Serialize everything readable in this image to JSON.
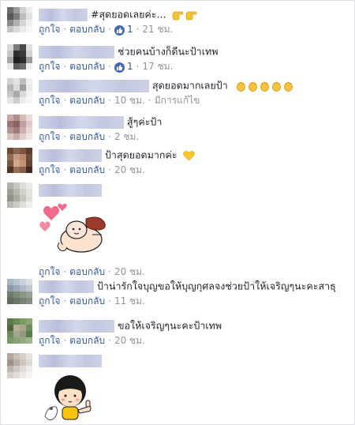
{
  "comments": [
    {
      "text": "#สุดยอดเลยค่ะ",
      "trailing": "...",
      "emoji": [
        "thumb-pointing-icon",
        "thumb-pointing-icon"
      ],
      "like": "ถูกใจ",
      "reply": "ตอบกลับ",
      "reactions": "1",
      "time": "21 ชม."
    },
    {
      "text": "ช่วยคนบ้างก็ดีนะป้าเทพ",
      "like": "ถูกใจ",
      "reply": "ตอบกลับ",
      "reactions": "1",
      "time": "17 ชม."
    },
    {
      "text": "สุดยอดมากเลยป้า",
      "emoji": [
        "clap-icon",
        "clap-icon",
        "clap-icon",
        "clap-icon",
        "clap-icon"
      ],
      "like": "ถูกใจ",
      "reply": "ตอบกลับ",
      "time": "10 ชม.",
      "edited": "มีการแก้ไข"
    },
    {
      "text": "สู้ๆค่ะป้า",
      "like": "ถูกใจ",
      "reply": "ตอบกลับ",
      "time": "2 ชม."
    },
    {
      "text": "ป้าสุดยอดมากค่ะ",
      "emoji": [
        "yellow-heart-icon"
      ],
      "like": "ถูกใจ",
      "reply": "ตอบกลับ",
      "time": "20 ชม."
    },
    {
      "sticker": "hearts-sticker",
      "like": "ถูกใจ",
      "reply": "ตอบกลับ",
      "time": "20 ชม."
    },
    {
      "text": "ป้าน่ารักใจบุญขอให้บุญกุศลจงช่วยป้าให้เจริญๆนะคะสาธุ",
      "like": "ถูกใจ",
      "reply": "ตอบกลับ",
      "time": "11 ชม."
    },
    {
      "text": "ขอให้เจริญๆนะคะป้าเทพ",
      "like": "ถูกใจ",
      "reply": "ตอบกลับ",
      "time": "20 ชม."
    },
    {
      "sticker": "girl-thumbs-up-sticker"
    }
  ],
  "colors": {
    "link": "#365899",
    "meta": "#90949c",
    "text": "#1d2129",
    "like_badge": "#4267b2"
  }
}
